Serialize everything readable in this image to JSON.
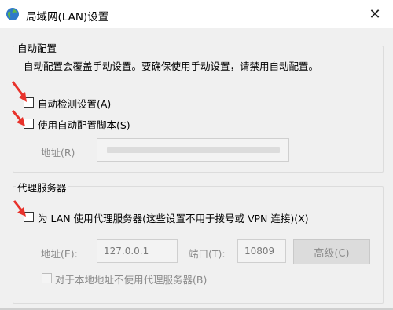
{
  "window": {
    "title": "局域网(LAN)设置",
    "close_glyph": "✕",
    "icon": "globe-icon"
  },
  "auto_config": {
    "group_title": "自动配置",
    "description": "自动配置会覆盖手动设置。要确保使用手动设置，请禁用自动配置。",
    "auto_detect_label": "自动检测设置(A)",
    "auto_detect_checked": false,
    "use_script_label": "使用自动配置脚本(S)",
    "use_script_checked": false,
    "address_label": "地址(R)",
    "address_value_blurred": true
  },
  "proxy": {
    "group_title": "代理服务器",
    "use_proxy_label": "为 LAN 使用代理服务器(这些设置不用于拨号或 VPN 连接)(X)",
    "use_proxy_checked": false,
    "address_label": "地址(E):",
    "address_value": "127.0.0.1",
    "port_label": "端口(T):",
    "port_value": "10809",
    "advanced_button": "高级(C)",
    "bypass_local_label": "对于本地地址不使用代理服务器(B)",
    "bypass_local_checked": false
  },
  "annotations": {
    "arrow_color": "#e8322b"
  }
}
